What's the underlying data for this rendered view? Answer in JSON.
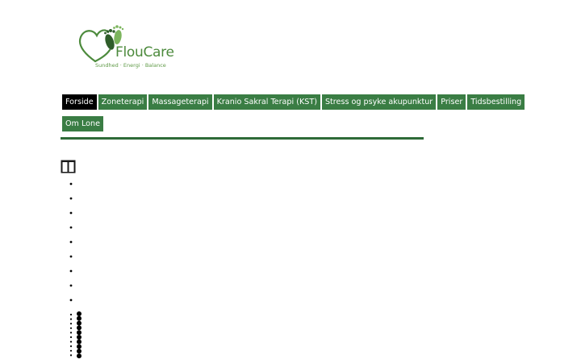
{
  "brand": {
    "name": "FlouCare",
    "tagline": "Sundhed · Energi · Balance",
    "colors": {
      "primary": "#4c8a3c",
      "accent": "#3a7d44",
      "active": "#000000",
      "rule": "#2e6b38"
    }
  },
  "nav": {
    "row1": [
      {
        "label": "Forside",
        "active": true
      },
      {
        "label": "Zoneterapi"
      },
      {
        "label": "Massageterapi"
      },
      {
        "label": "Kranio Sakral Terapi (KST)"
      },
      {
        "label": "Stress og psyke akupunktur"
      },
      {
        "label": "Priser"
      },
      {
        "label": "Tidsbestilling"
      }
    ],
    "row2": [
      {
        "label": "Om Lone"
      }
    ]
  },
  "content": {
    "icon": "grid-columns-icon",
    "bullet_list_items": 9,
    "nested_list_bullets": 10
  }
}
